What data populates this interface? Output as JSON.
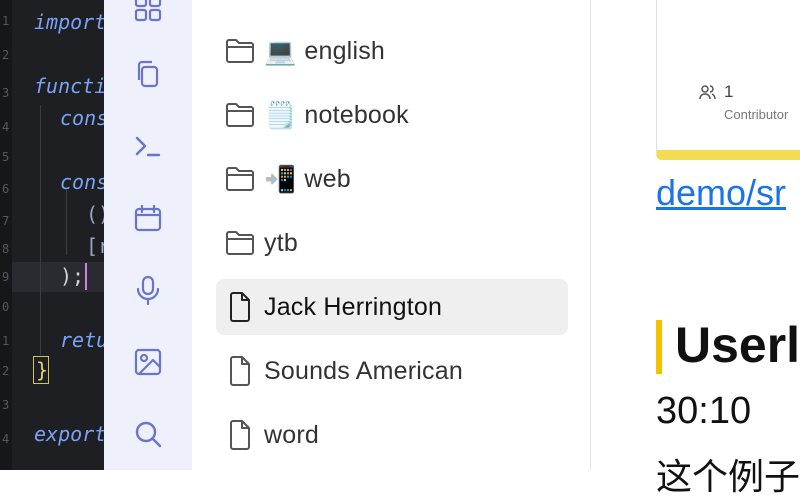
{
  "editor": {
    "lines": [
      "import",
      "",
      "functi",
      "cons",
      "",
      "cons",
      "()",
      "[r",
      ");",
      "",
      "retu",
      "}",
      "",
      "export"
    ],
    "line_numbers": [
      "1",
      "2",
      "3",
      "4",
      "5",
      "6",
      "7",
      "8",
      "9",
      "0",
      "1",
      "2",
      "3",
      "4"
    ]
  },
  "rail": {
    "icons": [
      "layout-icon",
      "copy-icon",
      "terminal-icon",
      "calendar-icon",
      "microphone-icon",
      "image-icon",
      "search-icon"
    ]
  },
  "files": [
    {
      "type": "folder",
      "emoji": "💻",
      "label": "english"
    },
    {
      "type": "folder",
      "emoji": "🗒️",
      "label": "notebook"
    },
    {
      "type": "folder",
      "emoji": "📲",
      "label": "web"
    },
    {
      "type": "folder",
      "emoji": "",
      "label": "ytb"
    },
    {
      "type": "file",
      "emoji": "",
      "label": "Jack Herrington",
      "selected": true
    },
    {
      "type": "file",
      "emoji": "",
      "label": "Sounds American"
    },
    {
      "type": "file",
      "emoji": "",
      "label": "word"
    }
  ],
  "content": {
    "contributors_count": "1",
    "contributors_label": "Contributor",
    "demo_link": "demo/sr",
    "heading": "Userl",
    "timestamp": "30:10",
    "cjk_text": "这个例子"
  },
  "colors": {
    "accent_yellow": "#f2dd52",
    "link_blue": "#1a73e8",
    "rail_bg": "#eef0fc"
  }
}
